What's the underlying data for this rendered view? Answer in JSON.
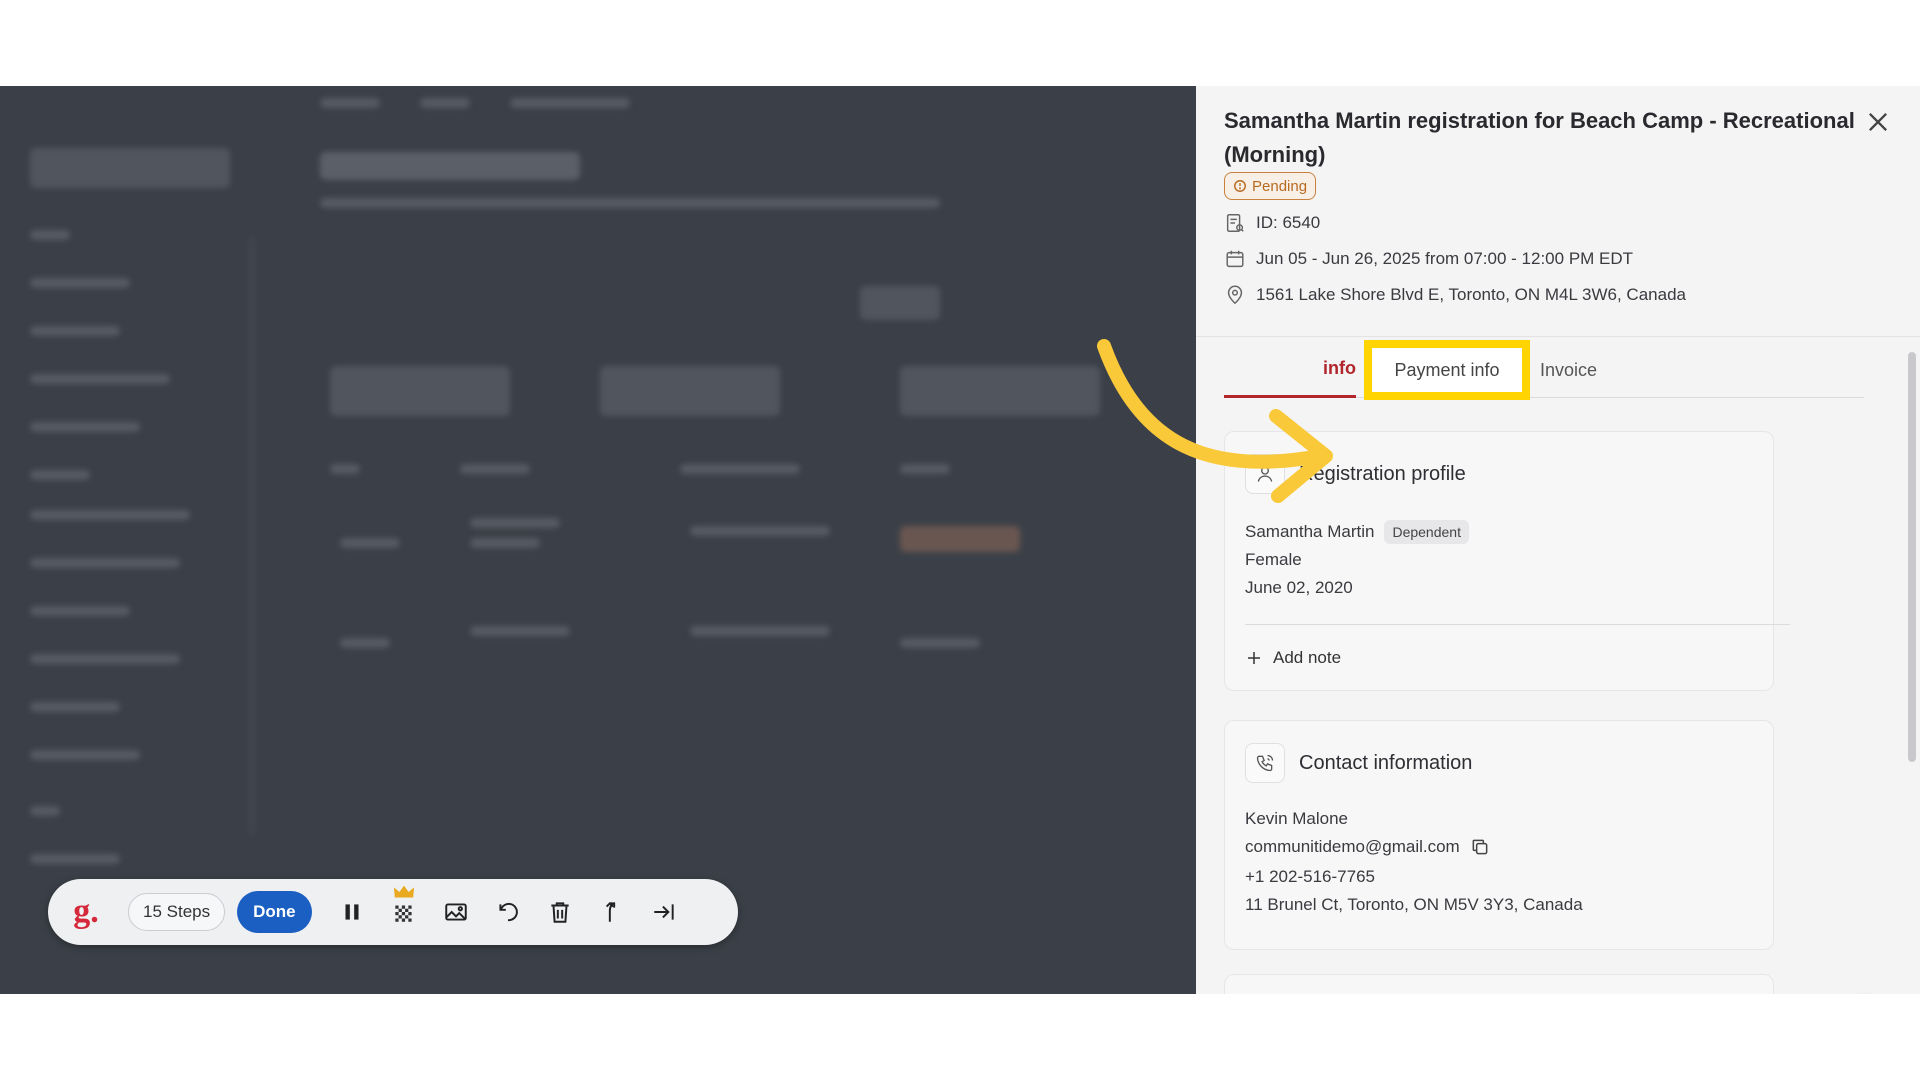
{
  "panel": {
    "title": "Samantha Martin registration for Beach Camp - Recreational (Morning)",
    "status": "Pending",
    "id_line": "ID: 6540",
    "date_line": "Jun 05 - Jun 26, 2025 from 07:00 - 12:00 PM EDT",
    "address_line": "1561 Lake Shore Blvd E, Toronto, ON M4L 3W6, Canada"
  },
  "tabs": [
    {
      "label": "info",
      "active": true
    },
    {
      "label": "Payment info",
      "highlighted": true
    },
    {
      "label": "Invoice"
    }
  ],
  "registration_profile": {
    "title": "Registration profile",
    "name": "Samantha Martin",
    "tag": "Dependent",
    "gender": "Female",
    "birthdate": "June 02, 2020",
    "add_note": "Add note"
  },
  "contact_information": {
    "title": "Contact information",
    "name": "Kevin Malone",
    "email": "communitidemo@gmail.com",
    "phone": "+1 202-516-7765",
    "address": "11 Brunel Ct, Toronto, ON M5V 3Y3, Canada"
  },
  "toolbar": {
    "logo": "g.",
    "steps": "15 Steps",
    "done": "Done"
  },
  "colors": {
    "accent": "#b0262b",
    "highlight": "#ffd400",
    "done_button": "#1a5fc1",
    "pending": "#c9823e"
  }
}
